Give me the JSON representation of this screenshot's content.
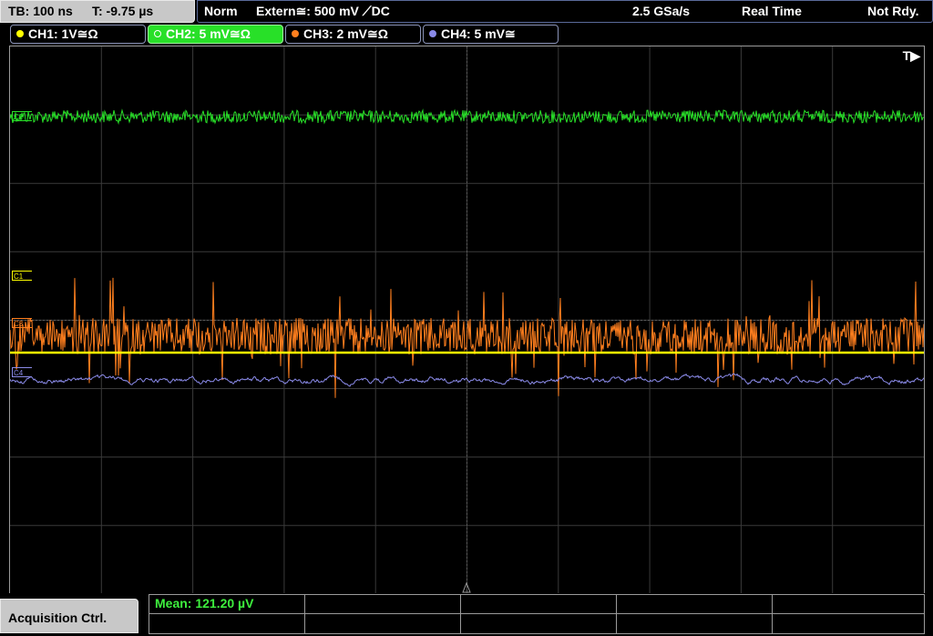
{
  "topbar": {
    "timebase": "TB: 100 ns",
    "trigger_time": "T: -9.75 µs",
    "mode": "Norm",
    "trigger_source": "Extern≅: 500 mV ⟋DC",
    "sample_rate": "2.5 GSa/s",
    "acq_mode": "Real Time",
    "status": "Not Rdy."
  },
  "channels": [
    {
      "label": "CH1: 1V≅Ω",
      "color": "#ffff00"
    },
    {
      "label": "CH2: 5 mV≅Ω",
      "color": "#28e028"
    },
    {
      "label": "CH3: 2 mV≅Ω",
      "color": "#ff7f1e"
    },
    {
      "label": "CH4: 5 mV≅",
      "color": "#8a8ae8"
    }
  ],
  "markers": {
    "c1": "C1",
    "c2": "C2",
    "c3": "C3",
    "c4": "C4"
  },
  "trigger_indicator": "T▶",
  "bottom": {
    "acq_ctrl": "Acquisition Ctrl.",
    "mean": "Mean: 121.20 µV"
  }
}
